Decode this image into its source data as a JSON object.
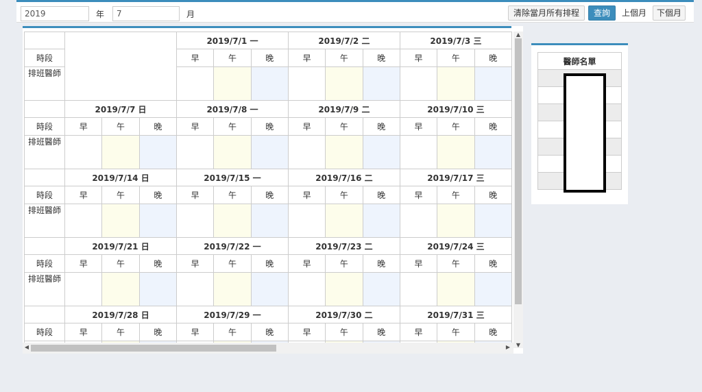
{
  "toolbar": {
    "year_value": "2019",
    "year_unit": "年",
    "month_value": "7",
    "month_unit": "月",
    "clear_label": "清除當月所有排程",
    "query_label": "查詢",
    "prev_label": "上個月",
    "next_label": "下個月"
  },
  "calendar": {
    "label_period": "時段",
    "label_doctor": "排班醫師",
    "shift_labels": [
      "早",
      "午",
      "晚"
    ],
    "weeks": [
      {
        "days": [
          "",
          "2019/7/1 一",
          "2019/7/2 二",
          "2019/7/3 三"
        ]
      },
      {
        "days": [
          "2019/7/7 日",
          "2019/7/8 一",
          "2019/7/9 二",
          "2019/7/10 三"
        ]
      },
      {
        "days": [
          "2019/7/14 日",
          "2019/7/15 一",
          "2019/7/16 二",
          "2019/7/17 三"
        ]
      },
      {
        "days": [
          "2019/7/21 日",
          "2019/7/22 一",
          "2019/7/23 二",
          "2019/7/24 三"
        ]
      },
      {
        "days": [
          "2019/7/28 日",
          "2019/7/29 一",
          "2019/7/30 二",
          "2019/7/31 三"
        ]
      }
    ]
  },
  "doctor_list": {
    "title": "醫師名單"
  }
}
